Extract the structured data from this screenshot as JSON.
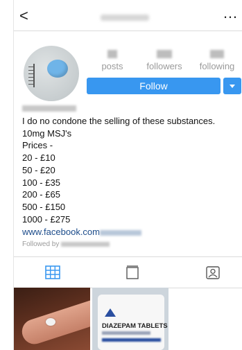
{
  "header": {
    "back_icon": "chevron-left-icon",
    "back_glyph": "<",
    "more_glyph": "…",
    "more_icon": "more-options-icon"
  },
  "stats": [
    {
      "label": "posts"
    },
    {
      "label": "followers"
    },
    {
      "label": "following"
    }
  ],
  "actions": {
    "follow_label": "Follow"
  },
  "bio": {
    "lines": "I do no condone the selling of these substances.\n10mg MSJ's\nPrices -\n20 - £10\n50 - £20\n100 - £35\n200 - £65\n500 - £150\n1000 - £275",
    "link_text": "www.facebook.com",
    "followed_by_label": "Followed by"
  },
  "tabs": [
    {
      "icon": "grid-icon"
    },
    {
      "icon": "feed-icon"
    },
    {
      "icon": "tagged-icon"
    }
  ],
  "posts": [
    {
      "icon": "pill-on-finger-image"
    },
    {
      "icon": "diazepam-jar-image",
      "label": "DIAZEPAM TABLETS"
    }
  ],
  "colors": {
    "accent": "#3897f0",
    "link": "#1b4b8a",
    "muted": "#9a9a9a"
  }
}
